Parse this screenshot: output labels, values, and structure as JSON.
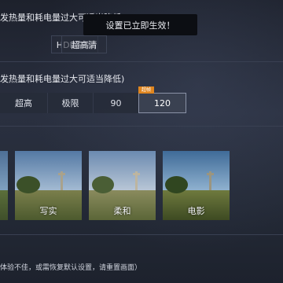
{
  "toast": "设置已立即生效！",
  "section_notes": {
    "hdr": "发热量和耗电量过大可适当降低)",
    "fps": "发热量和耗电量过大可适当降低)",
    "bottom": "体验不佳，或需恢复默认设置，请重置画面）"
  },
  "graphics_options": [
    "HDR高清",
    "超高清"
  ],
  "fps_options": [
    "超高",
    "极限",
    "90",
    "120"
  ],
  "fps_selected": "120",
  "fps_badge": "超帧",
  "styles": [
    "写实",
    "柔和",
    "电影"
  ],
  "colors": {
    "accent": "#e0861f",
    "background": "#262b38",
    "selected_border": "#8a92a6"
  }
}
